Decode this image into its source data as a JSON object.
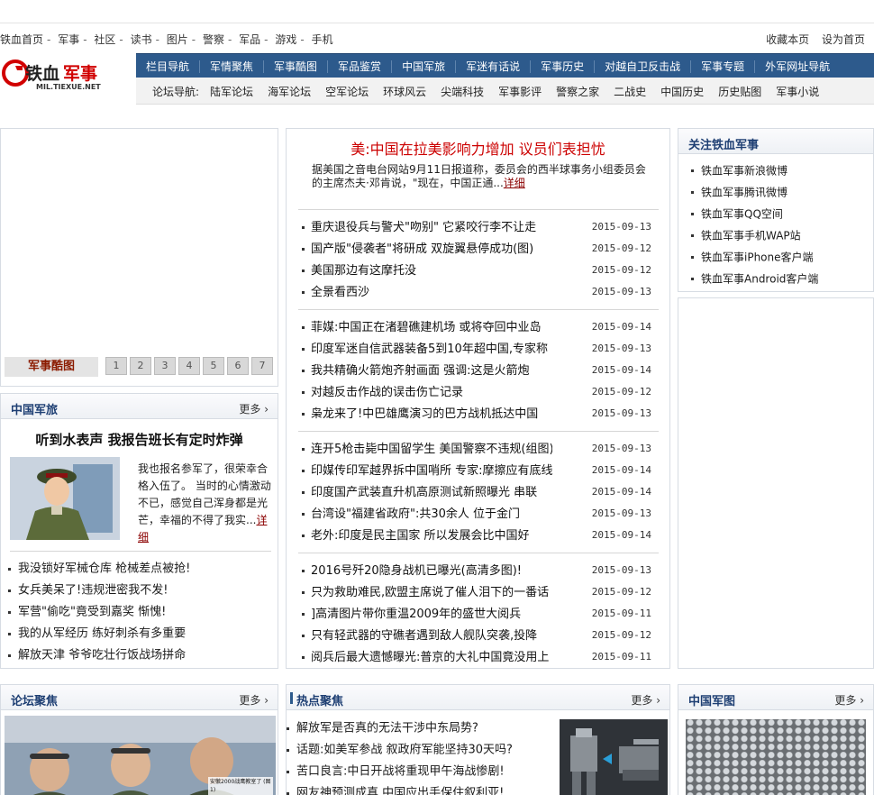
{
  "topnav": {
    "items": [
      "铁血首页",
      "军事",
      "社区",
      "读书",
      "图片",
      "警察",
      "军品",
      "游戏",
      "手机"
    ],
    "sep": "-",
    "bookmark": "收藏本页",
    "sethome": "设为首页"
  },
  "logo": {
    "brand_a": "铁血",
    "brand_b": "军事",
    "url_text": "MIL.TIEXUE.NET"
  },
  "mainnav": [
    "栏目导航",
    "军情聚焦",
    "军事酷图",
    "军品鉴赏",
    "中国军旅",
    "军迷有话说",
    "军事历史",
    "对越自卫反击战",
    "军事专题",
    "外军网址导航"
  ],
  "subnav": {
    "label": "论坛导航:",
    "items": [
      "陆军论坛",
      "海军论坛",
      "空军论坛",
      "环球风云",
      "尖端科技",
      "军事影评",
      "警察之家",
      "二战史",
      "中国历史",
      "历史贴图",
      "军事小说"
    ]
  },
  "slider": {
    "label": "军事酷图",
    "pages": [
      "1",
      "2",
      "3",
      "4",
      "5",
      "6",
      "7"
    ]
  },
  "junlv": {
    "title": "中国军旅",
    "more": "更多",
    "headline": "听到水表声 我报告班长有定时炸弹",
    "lede": "我也报名参军了，很荣幸合格入伍了。 当时的心情激动不已，感觉自己浑身都是光芒，幸福的不得了我实...",
    "detail": "详细",
    "items": [
      "我没锁好军械仓库 枪械差点被抢!",
      "女兵美呆了!违规泄密我不发!",
      "军营\"偷吃\"竟受到嘉奖 惭愧!",
      "我的从军经历 练好刺杀有多重要",
      "解放天津 爷爷吃壮行饭战场拼命"
    ]
  },
  "center": {
    "headline": "美:中国在拉美影响力增加 议员们表担忧",
    "lede": "据美国之音电台网站9月11日报道称，委员会的西半球事务小组委员会的主席杰夫·邓肯说，\"现在，中国正通...",
    "detail": "详细",
    "groups": [
      [
        {
          "t": "重庆退役兵与警犬\"吻别\" 它紧咬行李不让走",
          "d": "2015-09-13"
        },
        {
          "t": "国产版\"侵袭者\"将研成 双旋翼悬停成功(图)",
          "d": "2015-09-12"
        },
        {
          "t": "美国那边有这摩托没",
          "d": "2015-09-12"
        },
        {
          "t": "全景看西沙",
          "d": "2015-09-13"
        }
      ],
      [
        {
          "t": "菲媒:中国正在渚碧礁建机场 或将夺回中业岛",
          "d": "2015-09-14"
        },
        {
          "t": "印度军迷自信武器装备5到10年超中国,专家称",
          "d": "2015-09-13"
        },
        {
          "t": "我共精确火箭炮齐射画面 强调:这是火箭炮",
          "d": "2015-09-14"
        },
        {
          "t": "对越反击作战的误击伤亡记录",
          "d": "2015-09-12"
        },
        {
          "t": "枭龙来了!中巴雄鹰演习的巴方战机抵达中国",
          "d": "2015-09-13"
        }
      ],
      [
        {
          "t": "连开5枪击毙中国留学生 美国警察不违规(组图)",
          "d": "2015-09-13"
        },
        {
          "t": "印媒传印军越界拆中国哨所 专家:摩擦应有底线",
          "d": "2015-09-14"
        },
        {
          "t": "印度国产武装直升机高原测试新照曝光 串联",
          "d": "2015-09-14"
        },
        {
          "t": "台湾设\"福建省政府\":共30余人 位于金门",
          "d": "2015-09-13"
        },
        {
          "t": "老外:印度是民主国家 所以发展会比中国好",
          "d": "2015-09-14"
        }
      ],
      [
        {
          "t": "2016号歼20隐身战机已曝光(高清多图)!",
          "d": "2015-09-13"
        },
        {
          "t": "只为救助难民,欧盟主席说了催人泪下的一番话",
          "d": "2015-09-12"
        },
        {
          "t": "]高清图片带你重温2009年的盛世大阅兵",
          "d": "2015-09-11"
        },
        {
          "t": "只有轻武器的守礁者遇到敌人舰队突袭,投降",
          "d": "2015-09-12"
        },
        {
          "t": "阅兵后最大遗憾曝光:普京的大礼中国竟没用上",
          "d": "2015-09-11"
        }
      ]
    ]
  },
  "follow": {
    "title": "关注铁血军事",
    "items": [
      "铁血军事新浪微博",
      "铁血军事腾讯微博",
      "铁血军事QQ空间",
      "铁血军事手机WAP站",
      "铁血军事iPhone客户端",
      "铁血军事Android客户端"
    ]
  },
  "luntan": {
    "title": "论坛聚焦",
    "more": "更多",
    "caption": "安徽2000战鹰教室了 (图1)"
  },
  "hot": {
    "title": "热点聚焦",
    "more": "更多",
    "items": [
      "解放军是否真的无法干涉中东局势?",
      "话题:如美军参战 叙政府军能坚持30天吗?",
      "苦口良言:中日开战将重现甲午海战惨剧!",
      "网友神预测成真 中国应出手保住叙利亚!"
    ]
  },
  "junTu": {
    "title": "中国军图",
    "more": "更多"
  },
  "colors": {
    "nav_blue": "#2d5a8c",
    "headline_red": "#cc0000",
    "title_blue": "#1e3f73",
    "detail_red": "#8b0000"
  }
}
